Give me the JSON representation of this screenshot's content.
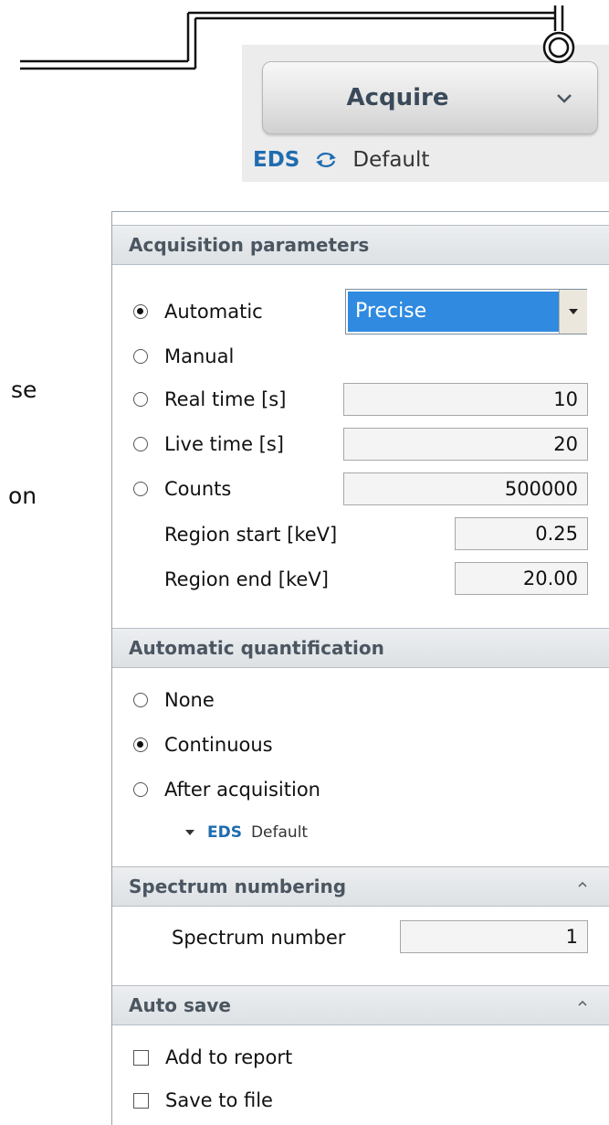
{
  "clipped_text": {
    "line1": "se",
    "line2": "on"
  },
  "acquire_widget": {
    "button_label": "Acquire",
    "dropdown_icon": "chevron-down-icon",
    "detector_label": "EDS",
    "sync_icon": "sync-arrows-icon",
    "recipe_label": "Default"
  },
  "acquisition_parameters": {
    "header": "Acquisition parameters",
    "automatic": {
      "label": "Automatic",
      "checked": true,
      "mode_value": "Precise"
    },
    "manual": {
      "label": "Manual",
      "checked": false
    },
    "real_time": {
      "label": "Real time [s]",
      "checked": false,
      "value": "10"
    },
    "live_time": {
      "label": "Live time [s]",
      "checked": false,
      "value": "20"
    },
    "counts": {
      "label": "Counts",
      "checked": false,
      "value": "500000"
    },
    "region_start": {
      "label": "Region start [keV]",
      "value": "0.25"
    },
    "region_end": {
      "label": "Region end [keV]",
      "value": "20.00"
    }
  },
  "automatic_quantification": {
    "header": "Automatic quantification",
    "options": [
      {
        "label": "None",
        "checked": false
      },
      {
        "label": "Continuous",
        "checked": true
      },
      {
        "label": "After acquisition",
        "checked": false
      }
    ],
    "detector_label": "EDS",
    "recipe_label": "Default"
  },
  "spectrum_numbering": {
    "header": "Spectrum numbering",
    "collapse_icon": "chevron-up-icon",
    "spectrum_number_label": "Spectrum number",
    "spectrum_number_value": "1"
  },
  "auto_save": {
    "header": "Auto save",
    "collapse_icon": "chevron-up-icon",
    "add_to_report": {
      "label": "Add to report",
      "checked": false
    },
    "save_to_file": {
      "label": "Save to file",
      "checked": false
    }
  }
}
